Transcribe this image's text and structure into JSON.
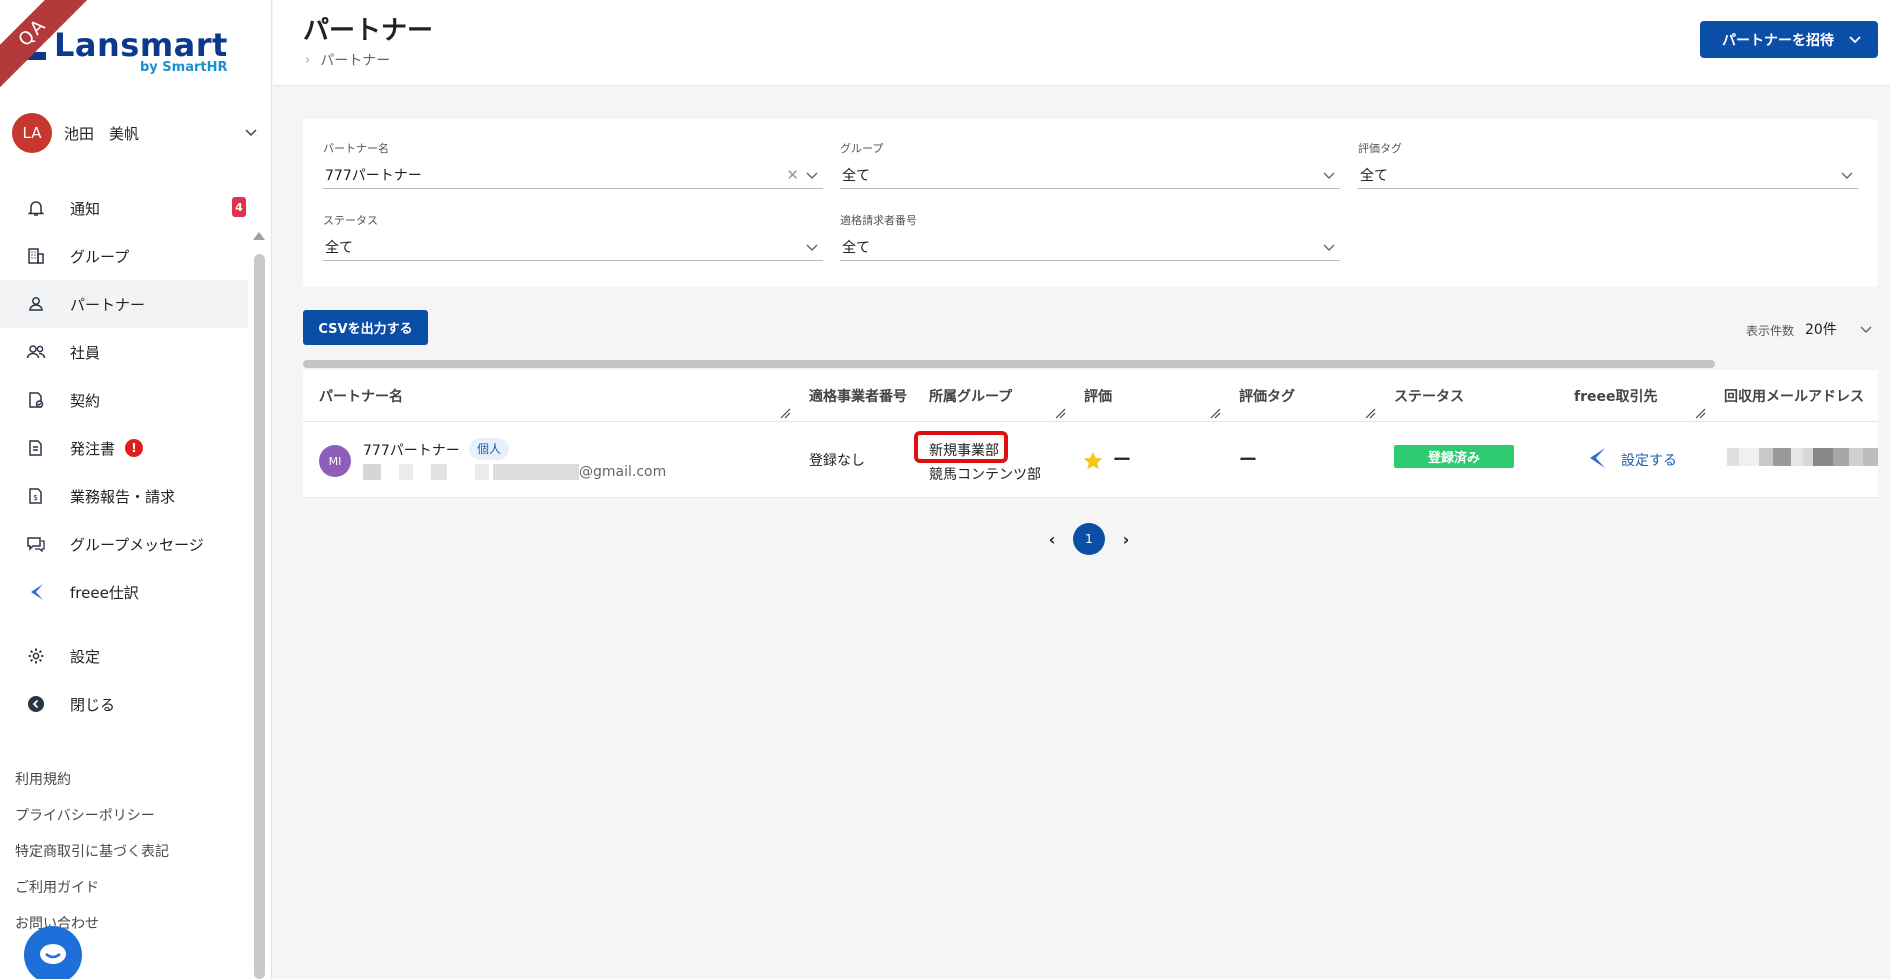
{
  "badge": {
    "qa": "QA"
  },
  "app": {
    "logo_text": "Lansmart",
    "logo_sub": "by SmartHR",
    "brand_color": "#0b3a8c",
    "accent_color": "#0b4ea8"
  },
  "user": {
    "initials": "LA",
    "name": "池田　美帆"
  },
  "sidebar": {
    "items": [
      {
        "label": "通知",
        "icon": "bell-icon",
        "badge": "4"
      },
      {
        "label": "グループ",
        "icon": "building-icon"
      },
      {
        "label": "パートナー",
        "icon": "person-icon",
        "active": true
      },
      {
        "label": "社員",
        "icon": "people-icon"
      },
      {
        "label": "契約",
        "icon": "contract-icon"
      },
      {
        "label": "発注書",
        "icon": "document-icon",
        "alert": "!"
      },
      {
        "label": "業務報告・請求",
        "icon": "invoice-icon"
      },
      {
        "label": "グループメッセージ",
        "icon": "chat-icon"
      },
      {
        "label": "freee仕訳",
        "icon": "freee-icon"
      },
      {
        "label": "設定",
        "icon": "gear-icon"
      },
      {
        "label": "閉じる",
        "icon": "close-circle-icon"
      }
    ],
    "footer_links": [
      "利用規約",
      "プライバシーポリシー",
      "特定商取引に基づく表記",
      "ご利用ガイド",
      "お問い合わせ"
    ]
  },
  "header": {
    "title": "パートナー",
    "breadcrumb": "パートナー",
    "invite_label": "パートナーを招待"
  },
  "filters": {
    "partner_name": {
      "label": "パートナー名",
      "value": "777パートナー"
    },
    "group": {
      "label": "グループ",
      "value": "全て"
    },
    "eval_tag": {
      "label": "評価タグ",
      "value": "全て"
    },
    "status": {
      "label": "ステータス",
      "value": "全て"
    },
    "invoice_no": {
      "label": "適格請求者番号",
      "value": "全て"
    }
  },
  "toolbar": {
    "csv_label": "CSVを出力する",
    "perpage_label": "表示件数",
    "perpage_value": "20件"
  },
  "table": {
    "columns": [
      "パートナー名",
      "適格事業者番号",
      "所属グループ",
      "評価",
      "評価タグ",
      "ステータス",
      "freee取引先",
      "回収用メールアドレス"
    ],
    "rows": [
      {
        "avatar": "MI",
        "name": "777パートナー",
        "type": "個人",
        "email_suffix": "@gmail.com",
        "qualified_no": "登録なし",
        "group_1": "新規事業部",
        "group_2": "競馬コンテンツ部",
        "rating": "ー",
        "eval_tag": "ー",
        "status": "登録済み",
        "freee_action": "設定する"
      }
    ]
  },
  "pagination": {
    "prev": "‹",
    "current": "1",
    "next": "›"
  },
  "colors": {
    "status_green": "#2ecc71",
    "highlight_red": "#e01010",
    "star_yellow": "#f5c518"
  }
}
